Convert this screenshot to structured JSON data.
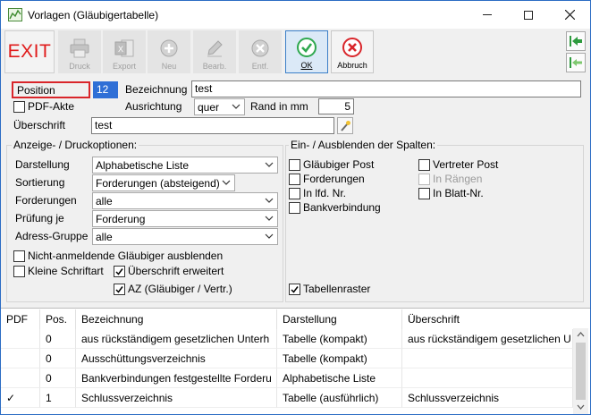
{
  "window": {
    "title": "Vorlagen (Gläubigertabelle)"
  },
  "toolbar": {
    "exit_label": "EXIT",
    "druck_label": "Druck",
    "export_label": "Export",
    "neu_label": "Neu",
    "bearb_label": "Bearb.",
    "entf_label": "Entf.",
    "ok_label": "OK",
    "abbruch_label": "Abbruch"
  },
  "form": {
    "position_label": "Position",
    "position_value": "12",
    "bezeichnung_label": "Bezeichnung",
    "bezeichnung_value": "test",
    "pdf_akte_label": "PDF-Akte",
    "ausrichtung_label": "Ausrichtung",
    "ausrichtung_value": "quer",
    "rand_label": "Rand in mm",
    "rand_value": "5",
    "ueberschrift_label": "Überschrift",
    "ueberschrift_value": "test"
  },
  "anzeige": {
    "title": "Anzeige- / Druckoptionen:",
    "darstellung_label": "Darstellung",
    "darstellung_value": "Alphabetische Liste",
    "sortierung_label": "Sortierung",
    "sortierung_value": "Forderungen (absteigend)",
    "forderungen_label": "Forderungen",
    "forderungen_value": "alle",
    "pruefung_label": "Prüfung je",
    "pruefung_value": "Forderung",
    "adress_label": "Adress-Gruppe",
    "adress_value": "alle",
    "nicht_anmeldende_label": "Nicht-anmeldende Gläubiger ausblenden",
    "kleine_schrift_label": "Kleine Schriftart",
    "ueberschrift_erweitert_label": "Überschrift erweitert",
    "az_label": "AZ (Gläubiger / Vertr.)"
  },
  "spalten": {
    "title": "Ein- / Ausblenden der Spalten:",
    "glaeubiger_post": "Gläubiger Post",
    "forderungen": "Forderungen",
    "in_lfd_nr": "In lfd. Nr.",
    "bankverbindung": "Bankverbindung",
    "vertreter_post": "Vertreter Post",
    "in_raengen": "In Rängen",
    "in_blatt_nr": "In Blatt-Nr.",
    "tabellenraster": "Tabellenraster"
  },
  "table": {
    "headers": [
      "PDF",
      "Pos.",
      "Bezeichnung",
      "Darstellung",
      "Überschrift"
    ],
    "rows": [
      [
        "",
        "0",
        "aus rückständigem gesetzlichen Unterh",
        "Tabelle (kompakt)",
        "aus rückständigem gesetzlichen U"
      ],
      [
        "",
        "0",
        "Ausschüttungsverzeichnis",
        "Tabelle (kompakt)",
        ""
      ],
      [
        "",
        "0",
        "Bankverbindungen festgestellte Forderu",
        "Alphabetische Liste",
        ""
      ],
      [
        "✓",
        "1",
        "Schlussverzeichnis",
        "Tabelle (ausführlich)",
        "Schlussverzeichnis"
      ]
    ]
  },
  "colors": {
    "exit_red": "#e01b1b",
    "ok_green": "#2fa84f",
    "cancel_red": "#d9252a",
    "nav_green": "#2e9b3e",
    "accent_blue": "#3c7fc8"
  }
}
